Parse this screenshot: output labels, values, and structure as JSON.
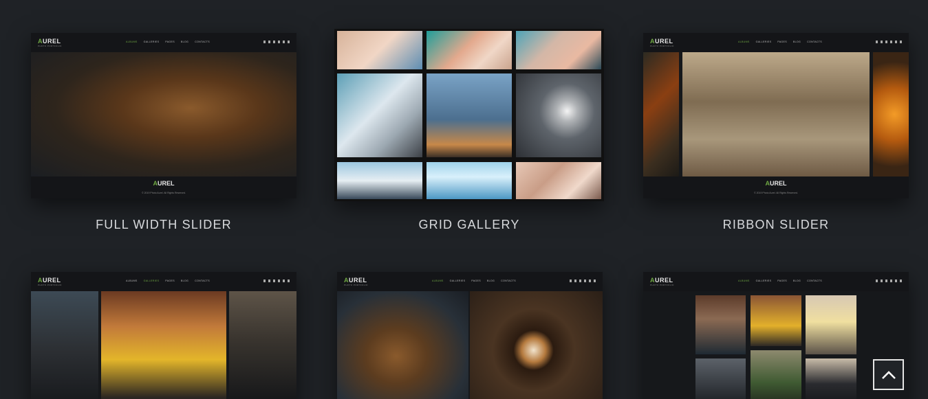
{
  "mini_site": {
    "logo_main": "URE",
    "logo_accent": "A",
    "logo_end": "L",
    "logo_tagline": "PHOTO PORTFOLIO",
    "nav": [
      "ALBUMS",
      "GALLERIES",
      "PAGES",
      "BLOG",
      "CONTACTS"
    ],
    "copyright": "© 2019 Photo Aurel. All Rights Reserved."
  },
  "demos": [
    {
      "title": "FULL WIDTH SLIDER",
      "active_nav": 0
    },
    {
      "title": "GRID GALLERY",
      "active_nav": -1
    },
    {
      "title": "RIBBON SLIDER",
      "active_nav": 0
    },
    {
      "title": "",
      "active_nav": 1
    },
    {
      "title": "",
      "active_nav": 0
    },
    {
      "title": "",
      "active_nav": 0
    }
  ],
  "icons": {
    "scroll_top": "chevron-up-icon",
    "social": [
      "facebook-icon",
      "twitter-icon",
      "vimeo-icon",
      "pinterest-icon",
      "instagram-icon",
      "search-icon"
    ]
  },
  "colors": {
    "background": "#1f2226",
    "accent": "#6fa843",
    "title_text": "#d8dadd"
  }
}
